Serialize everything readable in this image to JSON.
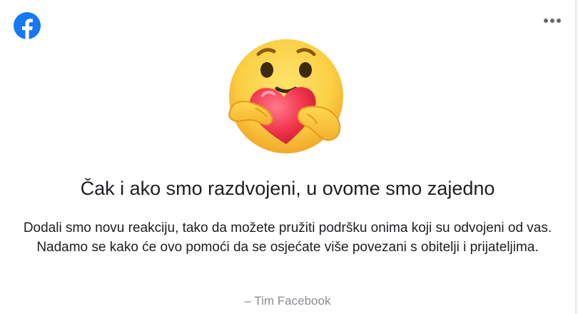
{
  "header": {
    "logo_icon": "facebook-logo-icon",
    "more_icon": "more-options-icon",
    "brand_color": "#1877f2"
  },
  "hero": {
    "emoji_icon": "care-reaction-emoji-icon"
  },
  "content": {
    "title": "Čak i ako smo razdvojeni, u ovome smo zajedno",
    "description": "Dodali smo novu reakciju, tako da možete pružiti podršku onima koji su odvojeni od vas. Nadamo se kako će ovo pomoći da se osjećate više povezani s obitelji i prijateljima.",
    "signature": "– Tim Facebook"
  }
}
